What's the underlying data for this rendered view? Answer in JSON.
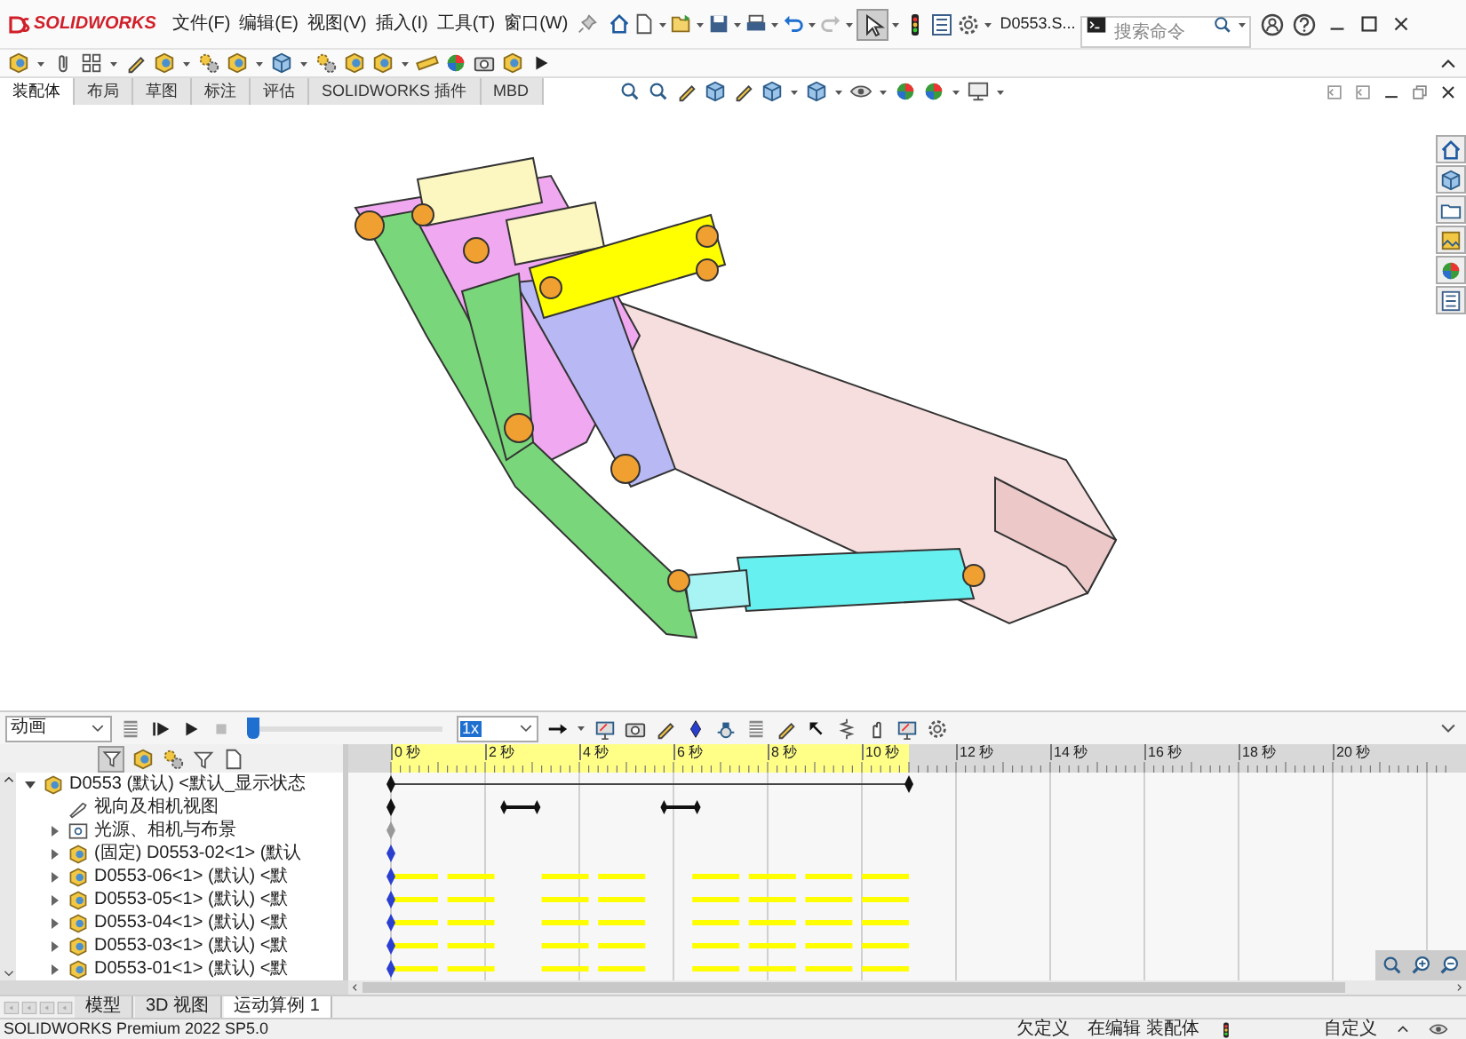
{
  "app": {
    "brand": "SOLIDWORKS",
    "menus": [
      "文件(F)",
      "编辑(E)",
      "视图(V)",
      "插入(I)",
      "工具(T)",
      "窗口(W)"
    ],
    "document": "D0553.S...",
    "search": {
      "placeholder": "搜索命令"
    }
  },
  "command_tabs": [
    {
      "label": "装配体",
      "selected": true
    },
    {
      "label": "布局",
      "selected": false
    },
    {
      "label": "草图",
      "selected": false
    },
    {
      "label": "标注",
      "selected": false
    },
    {
      "label": "评估",
      "selected": false
    },
    {
      "label": "SOLIDWORKS 插件",
      "selected": false
    },
    {
      "label": "MBD",
      "selected": false
    }
  ],
  "motion_manager": {
    "study_type": "动画",
    "playback_speed": "1x",
    "time_slider": {
      "level": 0
    },
    "ruler": [
      "0 秒",
      "2 秒",
      "4 秒",
      "6 秒",
      "8 秒",
      "10 秒",
      "12 秒",
      "14 秒",
      "16 秒",
      "18 秒",
      "20 秒"
    ],
    "tree": [
      {
        "kind": "assembly",
        "label": "D0553 (默认) <默认_显示状态",
        "expanded": true,
        "children": [
          {
            "kind": "camera",
            "label": "视向及相机视图"
          },
          {
            "kind": "lights",
            "label": "光源、相机与布景",
            "expanded": false
          },
          {
            "kind": "fixed_part",
            "label": "(固定) D0553-02<1> (默认",
            "expanded": false
          },
          {
            "kind": "part",
            "label": "D0553-06<1> (默认) <默",
            "expanded": false
          },
          {
            "kind": "part",
            "label": "D0553-05<1> (默认) <默",
            "expanded": false
          },
          {
            "kind": "part",
            "label": "D0553-04<1> (默认) <默",
            "expanded": false
          },
          {
            "kind": "part",
            "label": "D0553-03<1> (默认) <默",
            "expanded": false
          },
          {
            "kind": "part",
            "label": "D0553-01<1> (默认) <默",
            "expanded": false
          }
        ]
      }
    ]
  },
  "bottom_tabs": [
    {
      "label": "模型",
      "selected": false
    },
    {
      "label": "3D 视图",
      "selected": false
    },
    {
      "label": "运动算例 1",
      "selected": true
    }
  ],
  "status_bar": {
    "product": "SOLIDWORKS Premium 2022 SP5.0",
    "state": "欠定义",
    "editing": "在编辑 装配体",
    "units": "自定义"
  }
}
